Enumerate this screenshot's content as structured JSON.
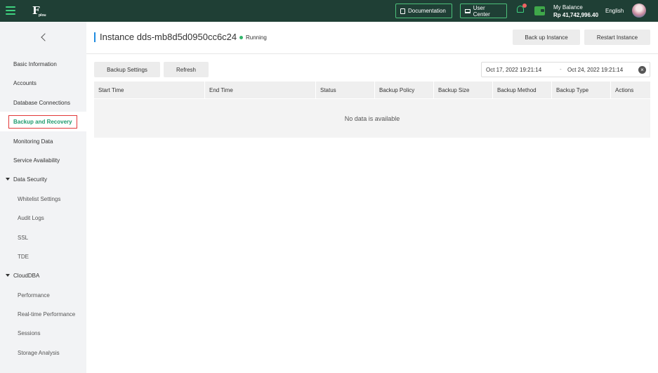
{
  "topbar": {
    "logo_text": "F",
    "logo_sub": "plou",
    "documentation_label": "Documentation",
    "user_center_label": "User Center",
    "balance_label": "My Balance",
    "balance_amount": "Rp 41,742,996.40",
    "language": "English"
  },
  "sidebar": {
    "items": [
      {
        "label": "Basic Information"
      },
      {
        "label": "Accounts"
      },
      {
        "label": "Database Connections"
      },
      {
        "label": "Backup and Recovery"
      },
      {
        "label": "Monitoring Data"
      },
      {
        "label": "Service Availability"
      },
      {
        "label": "Data Security"
      },
      {
        "label": "Whitelist Settings"
      },
      {
        "label": "Audit Logs"
      },
      {
        "label": "SSL"
      },
      {
        "label": "TDE"
      },
      {
        "label": "CloudDBA"
      },
      {
        "label": "Performance"
      },
      {
        "label": "Real-time Performance"
      },
      {
        "label": "Sessions"
      },
      {
        "label": "Storage Analysis"
      }
    ]
  },
  "header": {
    "title": "Instance dds-mb8d5d0950cc6c24",
    "status": "Running",
    "backup_button": "Back up Instance",
    "restart_button": "Restart Instance"
  },
  "toolbar": {
    "backup_settings": "Backup Settings",
    "refresh": "Refresh",
    "date_from": "Oct 17, 2022 19:21:14",
    "date_sep": "-",
    "date_to": "Oct 24, 2022 19:21:14",
    "clear_glyph": "×"
  },
  "table": {
    "columns": [
      "Start Time",
      "End Time",
      "Status",
      "Backup Policy",
      "Backup Size",
      "Backup Method",
      "Backup Type",
      "Actions"
    ],
    "empty_text": "No data is available"
  },
  "colors": {
    "topbar_bg": "#1f3f35",
    "accent_green": "#3fd17f",
    "active_text": "#1e9b6e",
    "highlight_border": "#e23838",
    "title_bar": "#1e8be0",
    "running_dot": "#33b56c"
  }
}
